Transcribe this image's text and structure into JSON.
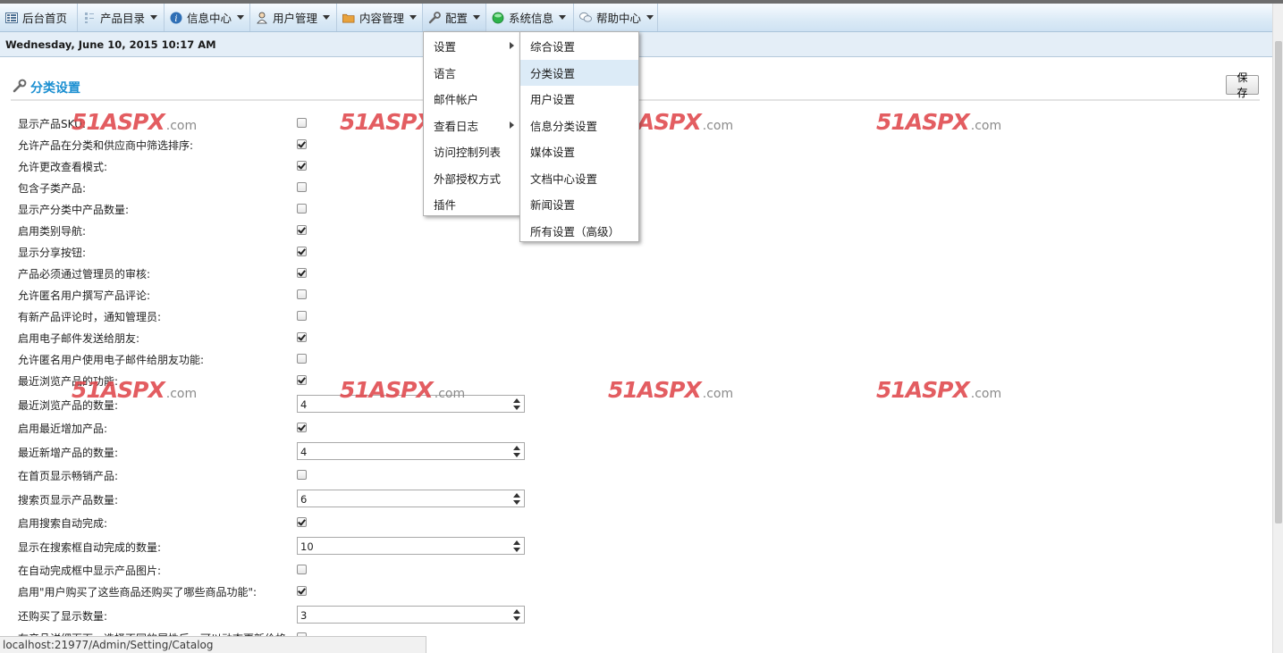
{
  "nav": {
    "items": [
      {
        "label": "后台首页",
        "icon": "home-grid-icon",
        "caret": false
      },
      {
        "label": "产品目录",
        "icon": "catalog-icon",
        "caret": true
      },
      {
        "label": "信息中心",
        "icon": "info-icon",
        "caret": true
      },
      {
        "label": "用户管理",
        "icon": "user-icon",
        "caret": true
      },
      {
        "label": "内容管理",
        "icon": "folder-icon",
        "caret": true
      },
      {
        "label": "配置",
        "icon": "wrench-icon",
        "caret": true
      },
      {
        "label": "系统信息",
        "icon": "green-circle-icon",
        "caret": true
      },
      {
        "label": "帮助中心",
        "icon": "help-chat-icon",
        "caret": true
      }
    ]
  },
  "date_bar": {
    "text": "Wednesday, June 10, 2015 10:17 AM"
  },
  "page": {
    "title": "分类设置",
    "save_label": "保存"
  },
  "settings": [
    {
      "label": "显示产品SKU:",
      "type": "checkbox",
      "checked": false
    },
    {
      "label": "允许产品在分类和供应商中筛选排序:",
      "type": "checkbox",
      "checked": true
    },
    {
      "label": "允许更改查看模式:",
      "type": "checkbox",
      "checked": true
    },
    {
      "label": "包含子类产品:",
      "type": "checkbox",
      "checked": false
    },
    {
      "label": "显示产分类中产品数量:",
      "type": "checkbox",
      "checked": false
    },
    {
      "label": "启用类别导航:",
      "type": "checkbox",
      "checked": true
    },
    {
      "label": "显示分享按钮:",
      "type": "checkbox",
      "checked": true
    },
    {
      "label": "产品必须通过管理员的审核:",
      "type": "checkbox",
      "checked": true
    },
    {
      "label": "允许匿名用户撰写产品评论:",
      "type": "checkbox",
      "checked": false
    },
    {
      "label": "有新产品评论时，通知管理员:",
      "type": "checkbox",
      "checked": false
    },
    {
      "label": "启用电子邮件发送给朋友:",
      "type": "checkbox",
      "checked": true
    },
    {
      "label": "允许匿名用户使用电子邮件给朋友功能:",
      "type": "checkbox",
      "checked": false
    },
    {
      "label": "最近浏览产品的功能:",
      "type": "checkbox",
      "checked": true
    },
    {
      "label": "最近浏览产品的数量:",
      "type": "number",
      "value": "4"
    },
    {
      "label": "启用最近增加产品:",
      "type": "checkbox",
      "checked": true
    },
    {
      "label": "最近新增产品的数量:",
      "type": "number",
      "value": "4"
    },
    {
      "label": "在首页显示畅销产品:",
      "type": "checkbox",
      "checked": false
    },
    {
      "label": "搜索页显示产品数量:",
      "type": "number",
      "value": "6"
    },
    {
      "label": "启用搜索自动完成:",
      "type": "checkbox",
      "checked": true
    },
    {
      "label": "显示在搜索框自动完成的数量:",
      "type": "number",
      "value": "10"
    },
    {
      "label": "在自动完成框中显示产品图片:",
      "type": "checkbox",
      "checked": false
    },
    {
      "label": "启用\"用户购买了这些商品还购买了哪些商品功能\":",
      "type": "checkbox",
      "checked": true
    },
    {
      "label": "还购买了显示数量:",
      "type": "number",
      "value": "3"
    },
    {
      "label": "在产品详细页面，选择不同的属性后，可以动态更新价格:",
      "type": "checkbox",
      "checked": false
    }
  ],
  "config_menu": {
    "items": [
      {
        "label": "设置",
        "has_submenu": true
      },
      {
        "label": "语言",
        "has_submenu": false
      },
      {
        "label": "邮件帐户",
        "has_submenu": false
      },
      {
        "label": "查看日志",
        "has_submenu": true
      },
      {
        "label": "访问控制列表",
        "has_submenu": false
      },
      {
        "label": "外部授权方式",
        "has_submenu": false
      },
      {
        "label": "插件",
        "has_submenu": false
      }
    ]
  },
  "settings_submenu": {
    "items": [
      {
        "label": "综合设置"
      },
      {
        "label": "分类设置",
        "highlighted": true
      },
      {
        "label": "用户设置"
      },
      {
        "label": "信息分类设置"
      },
      {
        "label": "媒体设置"
      },
      {
        "label": "文档中心设置"
      },
      {
        "label": "新闻设置"
      },
      {
        "label": "所有设置（高级）"
      }
    ]
  },
  "watermark": {
    "main": "51ASPX",
    "suffix": ".com",
    "color": "#e0474c"
  },
  "status_bar": {
    "url": "localhost:21977/Admin/Setting/Catalog"
  }
}
